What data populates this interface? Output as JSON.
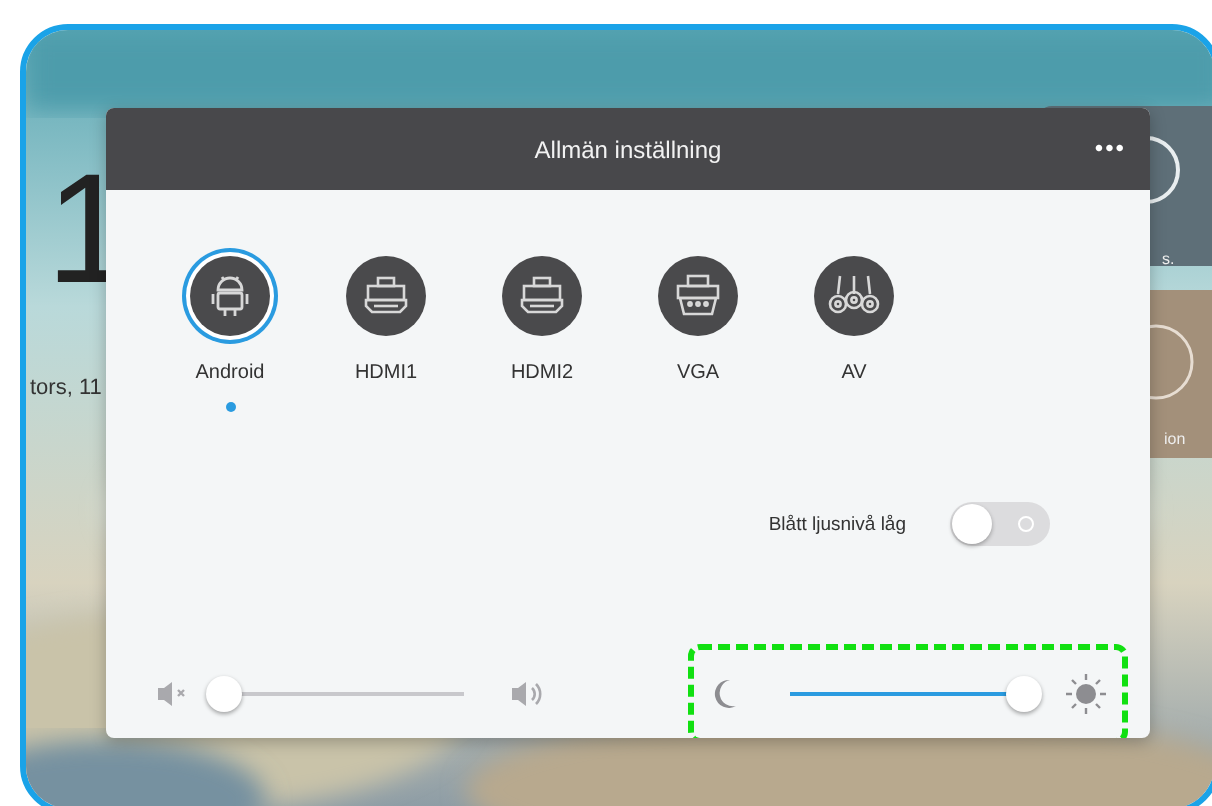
{
  "background": {
    "clock_digit": "1",
    "date_fragment": "tors, 11",
    "card_texts": [
      "s.",
      "ion"
    ]
  },
  "panel": {
    "title": "Allmän inställning",
    "menu": "•••"
  },
  "sources": [
    {
      "label": "Android",
      "selected": true
    },
    {
      "label": "HDMI1",
      "selected": false
    },
    {
      "label": "HDMI2",
      "selected": false
    },
    {
      "label": "VGA",
      "selected": false
    },
    {
      "label": "AV",
      "selected": false
    }
  ],
  "blue_light": {
    "label": "Blått ljusnivå låg",
    "on": false
  },
  "volume": {
    "level": 0.0
  },
  "brightness": {
    "level": 0.96,
    "highlighted": true
  }
}
